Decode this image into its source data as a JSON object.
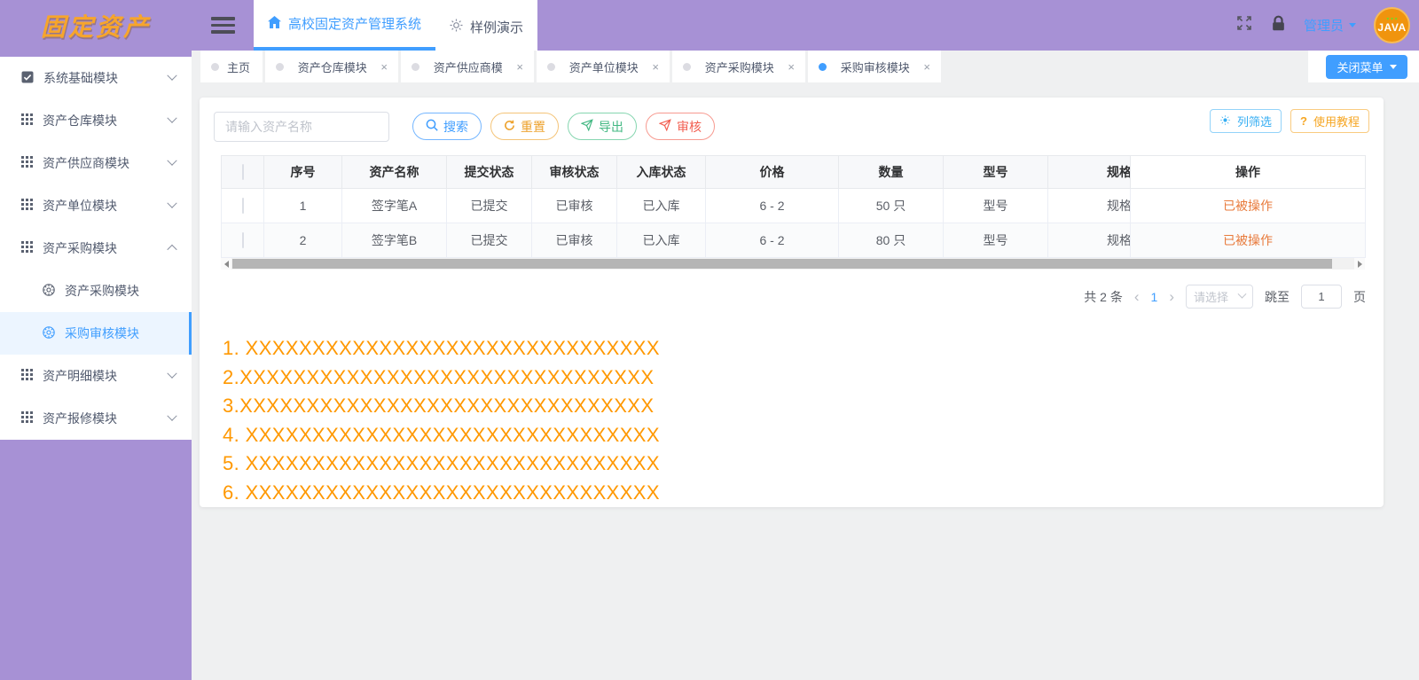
{
  "colors": {
    "purple": "#a791d5",
    "primary_blue": "#409eff",
    "warning_orange": "#eda22d",
    "success_green": "#43b883",
    "danger_red": "#f25e50",
    "light_blue": "#36aef3",
    "note_orange": "#ff9800",
    "action_orange": "#e87a3b",
    "logo_orange": "#f7a52b",
    "avatar_orange": "#f0940e"
  },
  "icons": {
    "close": "×",
    "prev": "‹",
    "next": "›",
    "question": "?"
  },
  "header": {
    "logo_text": "固定资产",
    "nav": [
      {
        "label": "高校固定资产管理系统"
      },
      {
        "label": "样例演示"
      }
    ],
    "user_name": "管理员",
    "avatar_text": "JAVA"
  },
  "tabbar": {
    "tabs": [
      {
        "label": "主页"
      },
      {
        "label": "资产仓库模块"
      },
      {
        "label": "资产供应商模"
      },
      {
        "label": "资产单位模块"
      },
      {
        "label": "资产采购模块"
      },
      {
        "label": "采购审核模块"
      }
    ],
    "close_menu": "关闭菜单"
  },
  "sidebar": {
    "items": [
      {
        "label": "系统基础模块"
      },
      {
        "label": "资产仓库模块"
      },
      {
        "label": "资产供应商模块"
      },
      {
        "label": "资产单位模块"
      },
      {
        "label": "资产采购模块"
      },
      {
        "label": "资产明细模块"
      },
      {
        "label": "资产报修模块"
      }
    ],
    "subitems": [
      {
        "label": "资产采购模块"
      },
      {
        "label": "采购审核模块"
      }
    ]
  },
  "toolbar": {
    "search_placeholder": "请输入资产名称",
    "search": "搜索",
    "reset": "重置",
    "export": "导出",
    "audit": "审核",
    "column_filter": "列筛选",
    "tutorial": "使用教程"
  },
  "table": {
    "headers": [
      "序号",
      "资产名称",
      "提交状态",
      "审核状态",
      "入库状态",
      "价格",
      "数量",
      "型号",
      "规格",
      "操作"
    ],
    "rows": [
      {
        "seq": "1",
        "name": "签字笔A",
        "submit": "已提交",
        "audit": "已审核",
        "storage": "已入库",
        "price": "6 - 2",
        "qty": "50 只",
        "model": "型号",
        "spec": "规格",
        "action": "已被操作"
      },
      {
        "seq": "2",
        "name": "签字笔B",
        "submit": "已提交",
        "audit": "已审核",
        "storage": "已入库",
        "price": "6 - 2",
        "qty": "80 只",
        "model": "型号",
        "spec": "规格",
        "action": "已被操作"
      }
    ]
  },
  "pagination": {
    "total": "共 2 条",
    "page": "1",
    "select_placeholder": "请选择",
    "jump_label": "跳至",
    "jump_value": "1",
    "unit_label": "页"
  },
  "notes": {
    "lines": [
      "1. XXXXXXXXXXXXXXXXXXXXXXXXXXXXXXX",
      "2.XXXXXXXXXXXXXXXXXXXXXXXXXXXXXXX",
      "3.XXXXXXXXXXXXXXXXXXXXXXXXXXXXXXX",
      "4. XXXXXXXXXXXXXXXXXXXXXXXXXXXXXXX",
      "5. XXXXXXXXXXXXXXXXXXXXXXXXXXXXXXX",
      "6. XXXXXXXXXXXXXXXXXXXXXXXXXXXXXXX"
    ]
  }
}
